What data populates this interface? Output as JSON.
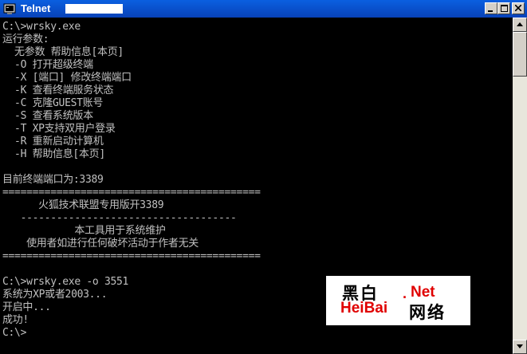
{
  "window": {
    "title": "Telnet",
    "icon": "terminal-icon",
    "buttons": {
      "minimize": "minimize-icon",
      "maximize": "maximize-icon",
      "close": "close-icon"
    }
  },
  "console": {
    "lines": [
      "C:\\>wrsky.exe",
      "运行参数:",
      "  无参数 帮助信息[本页]",
      "  -O 打开超级终端",
      "  -X [端口] 修改终端端口",
      "  -K 查看终端服务状态",
      "  -C 克隆GUEST账号",
      "  -S 查看系统版本",
      "  -T XP支持双用户登录",
      "  -R 重新启动计算机",
      "  -H 帮助信息[本页]",
      "",
      "目前终端端口为:3389",
      "===========================================",
      "      火狐技术联盟专用版开3389",
      "   ------------------------------------",
      "            本工具用于系统维护",
      "    使用者如进行任何破坏活动于作者无关",
      "===========================================",
      "",
      "C:\\>wrsky.exe -o 3551",
      "系统为XP或者2003...",
      "开启中...",
      "成功!",
      "C:\\>"
    ]
  },
  "watermark": {
    "cn_top": "黑白",
    "dot": ".",
    "net": "Net",
    "en": "HeiBai",
    "cn_bottom": "网络"
  },
  "colors": {
    "title_bar": "#0842b8",
    "console_bg": "#000000",
    "console_text": "#c0c0c0",
    "watermark_red": "#e00000"
  }
}
